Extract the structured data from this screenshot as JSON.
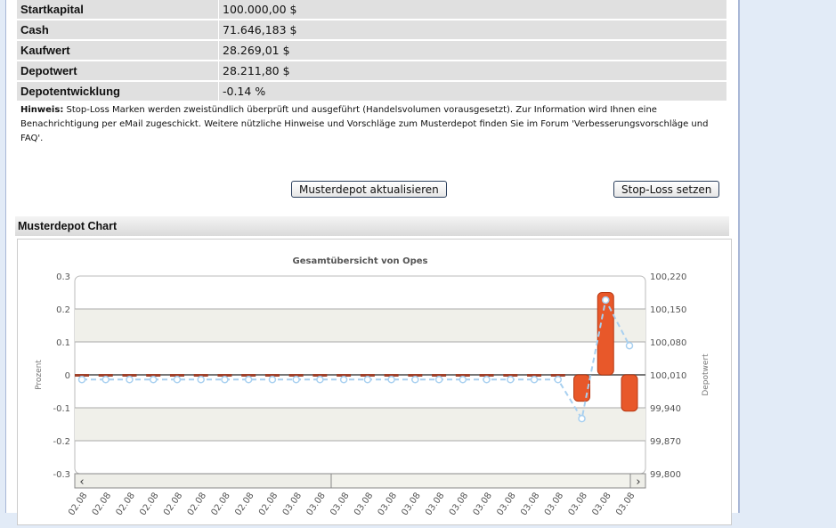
{
  "summary": [
    {
      "label": "Startkapital",
      "value": "100.000,00 $"
    },
    {
      "label": "Cash",
      "value": "71.646,183 $"
    },
    {
      "label": "Kaufwert",
      "value": "28.269,01 $"
    },
    {
      "label": "Depotwert",
      "value": "28.211,80 $"
    },
    {
      "label": "Depotentwicklung",
      "value": "-0.14 %"
    }
  ],
  "hint": {
    "label": "Hinweis:",
    "text": "Stop-Loss Marken werden zweistündlich überprüft und ausgeführt (Handelsvolumen vorausgesetzt). Zur Information wird Ihnen eine Benachrichtigung per eMail zugeschickt. Weitere nützliche Hinweise und Vorschläge zum Musterdepot finden Sie im Forum 'Verbesserungsvorschläge und FAQ'."
  },
  "buttons": {
    "update": "Musterdepot aktualisieren",
    "stoploss": "Stop-Loss setzen"
  },
  "chart_section_title": "Musterdepot Chart",
  "colors": {
    "bar": "#e8582a",
    "line": "#a8d0f0",
    "band": "#f0f0ea"
  },
  "chart_data": {
    "type": "bar+line",
    "title": "Gesamtübersicht von Opes",
    "ylabel_left": "Prozent",
    "ylabel_right": "Depotwert",
    "ylim_left": [
      -0.3,
      0.3
    ],
    "yticks_left": [
      "0.3",
      "0.2",
      "0.1",
      "0",
      "-0.1",
      "-0.2",
      "-0.3"
    ],
    "ylim_right": [
      99800,
      100220
    ],
    "yticks_right": [
      "100,220",
      "100,150",
      "100,080",
      "100,010",
      "99,940",
      "99,870",
      "99,800"
    ],
    "categories": [
      "02.08",
      "02.08",
      "02.08",
      "02.08",
      "02.08",
      "02.08",
      "02.08",
      "02.08",
      "02.08",
      "03.08",
      "03.08",
      "03.08",
      "03.08",
      "03.08",
      "03.08",
      "03.08",
      "03.08",
      "03.08",
      "03.08",
      "03.08",
      "03.08",
      "03.08",
      "03.08",
      "03.08"
    ],
    "series": [
      {
        "type": "bar",
        "axis": "left",
        "values": [
          0,
          0,
          0,
          0,
          0,
          0,
          0,
          0,
          0,
          0,
          0,
          0,
          0,
          0,
          0,
          0,
          0,
          0,
          0,
          0,
          0,
          -0.08,
          0.25,
          -0.11
        ]
      },
      {
        "type": "line",
        "axis": "right",
        "values": [
          100000,
          100000,
          100000,
          100000,
          100000,
          100000,
          100000,
          100000,
          100000,
          100000,
          100000,
          100000,
          100000,
          100000,
          100000,
          100000,
          100000,
          100000,
          100000,
          100000,
          100000,
          99917,
          100169,
          100072
        ]
      }
    ],
    "grid": true
  }
}
